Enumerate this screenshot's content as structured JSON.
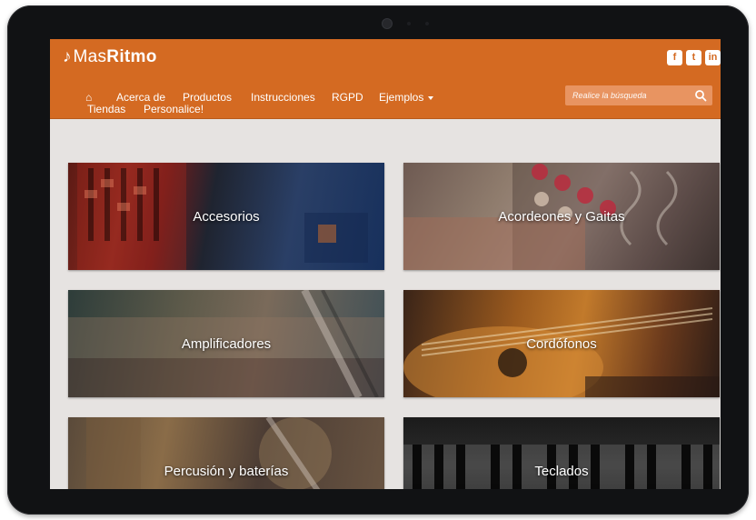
{
  "brand": {
    "note": "♪",
    "part1": "Mas",
    "part2": "Ritmo"
  },
  "social": [
    {
      "name": "facebook",
      "glyph": "f"
    },
    {
      "name": "twitter",
      "glyph": "t"
    },
    {
      "name": "linkedin",
      "glyph": "in"
    }
  ],
  "nav": {
    "home_glyph": "⌂",
    "items": [
      "Acerca de",
      "Productos",
      "Instrucciones",
      "RGPD",
      "Ejemplos",
      "Tiendas",
      "Personalice!"
    ]
  },
  "search": {
    "placeholder": "Realice la búsqueda"
  },
  "categories": [
    {
      "label": "Accesorios"
    },
    {
      "label": "Acordeones y Gaitas"
    },
    {
      "label": "Amplificadores"
    },
    {
      "label": "Cordófonos"
    },
    {
      "label": "Percusión y baterías"
    },
    {
      "label": "Teclados"
    }
  ],
  "colors": {
    "accent": "#d46a22",
    "background": "#e6e3e1",
    "bezel": "#111214"
  }
}
